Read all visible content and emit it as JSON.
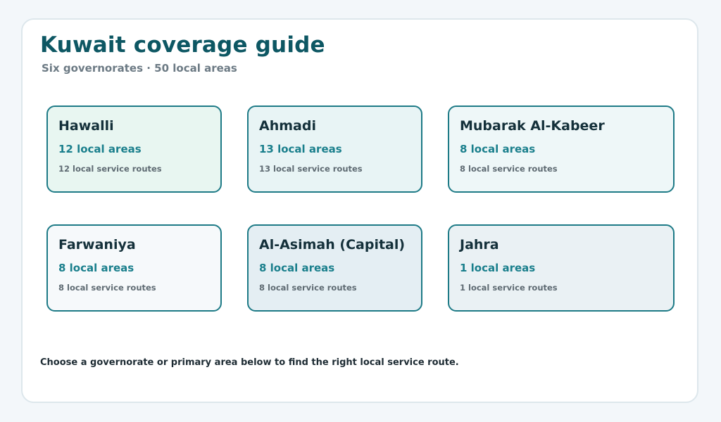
{
  "header": {
    "title": "Kuwait coverage guide",
    "subtitle": "Six governorates · 50 local areas"
  },
  "governorates": [
    {
      "name": "Hawalli",
      "areas": "12 local areas",
      "routes": "12 local service routes",
      "color": "#e8f6f1"
    },
    {
      "name": "Ahmadi",
      "areas": "13 local areas",
      "routes": "13 local service routes",
      "color": "#e8f4f5"
    },
    {
      "name": "Mubarak Al-Kabeer",
      "areas": "8 local areas",
      "routes": "8 local service routes",
      "color": "#eef7f8"
    },
    {
      "name": "Farwaniya",
      "areas": "8 local areas",
      "routes": "8 local service routes",
      "color": "#f6f9fb"
    },
    {
      "name": "Al-Asimah (Capital)",
      "areas": "8 local areas",
      "routes": "8 local service routes",
      "color": "#e4eef3"
    },
    {
      "name": "Jahra",
      "areas": "1 local areas",
      "routes": "1 local service routes",
      "color": "#eaf1f4"
    }
  ],
  "footer": {
    "note": "Choose a governorate or primary area below to find the right local service route."
  },
  "colors": {
    "accent": "#0d5763",
    "card_border": "#1d7a86",
    "count_text": "#1a7f8c"
  }
}
